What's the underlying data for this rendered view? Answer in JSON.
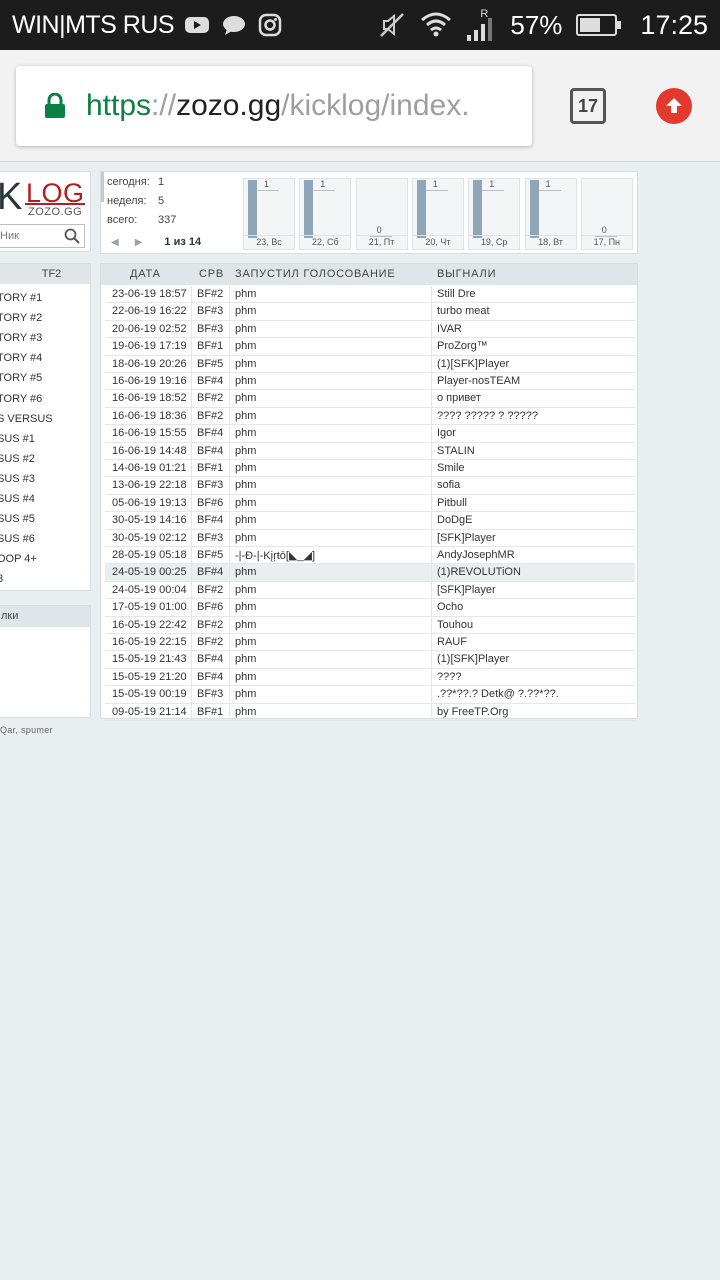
{
  "statusbar": {
    "carrier": "WIN|MTS RUS",
    "network_indicator": "R",
    "battery": "57%",
    "time": "17:25",
    "icons": [
      "youtube-icon",
      "chat-bubble-icon",
      "instagram-icon",
      "mute-icon",
      "wifi-icon",
      "signal-icon",
      "battery-icon"
    ]
  },
  "browser": {
    "url_scheme": "https",
    "url_sep": "://",
    "url_host": "zozo.gg",
    "url_path": "/kicklog/index.",
    "tab_count": "17"
  },
  "logo": {
    "k": "K",
    "log": "LOG",
    "sub": "ZOZO.GG",
    "nick_placeholder": "Ник"
  },
  "stats": {
    "today_label": "сегодня:",
    "today_value": "1",
    "week_label": "неделя:",
    "week_value": "5",
    "total_label": "всего:",
    "total_value": "337",
    "page": "1 из 14",
    "days": [
      {
        "label": "23, Вс",
        "value": 1
      },
      {
        "label": "22, Сб",
        "value": 1
      },
      {
        "label": "21, Пт",
        "value": 0
      },
      {
        "label": "20, Чт",
        "value": 1
      },
      {
        "label": "19, Ср",
        "value": 1
      },
      {
        "label": "18, Вт",
        "value": 1
      },
      {
        "label": "17, Пн",
        "value": 0
      }
    ]
  },
  "sidebar": {
    "header": "TF2",
    "items": [
      "TORY #1",
      "TORY #2",
      "TORY #3",
      "TORY #4",
      "TORY #5",
      "TORY #6",
      "S VERSUS",
      "SUS #1",
      "SUS #2",
      "SUS #3",
      "SUS #4",
      "SUS #5",
      "SUS #6",
      "OOP 4+",
      "3"
    ],
    "header2": "лки",
    "credits": "Qar, spumer"
  },
  "log": {
    "headers": {
      "date": "ДАТА",
      "server": "СРВ",
      "initiator": "ЗАПУСТИЛ ГОЛОСОВАНИЕ",
      "kicked": "ВЫГНАЛИ"
    },
    "rows": [
      {
        "date": "23-06-19 18:57",
        "server": "BF#2",
        "initiator": "phm",
        "kicked": "Still Dre"
      },
      {
        "date": "22-06-19 16:22",
        "server": "BF#3",
        "initiator": "phm",
        "kicked": "turbo meat"
      },
      {
        "date": "20-06-19 02:52",
        "server": "BF#3",
        "initiator": "phm",
        "kicked": "IVAR"
      },
      {
        "date": "19-06-19 17:19",
        "server": "BF#1",
        "initiator": "phm",
        "kicked": "ProZorg™"
      },
      {
        "date": "18-06-19 20:26",
        "server": "BF#5",
        "initiator": "phm",
        "kicked": "(1)[SFK]Player"
      },
      {
        "date": "16-06-19 19:16",
        "server": "BF#4",
        "initiator": "phm",
        "kicked": "Player-nosTEAM"
      },
      {
        "date": "16-06-19 18:52",
        "server": "BF#2",
        "initiator": "phm",
        "kicked": "о привет"
      },
      {
        "date": "16-06-19 18:36",
        "server": "BF#2",
        "initiator": "phm",
        "kicked": "???? ????? ? ?????"
      },
      {
        "date": "16-06-19 15:55",
        "server": "BF#4",
        "initiator": "phm",
        "kicked": "Igor"
      },
      {
        "date": "16-06-19 14:48",
        "server": "BF#4",
        "initiator": "phm",
        "kicked": "STALIN"
      },
      {
        "date": "14-06-19 01:21",
        "server": "BF#1",
        "initiator": "phm",
        "kicked": "Smile"
      },
      {
        "date": "13-06-19 22:18",
        "server": "BF#3",
        "initiator": "phm",
        "kicked": "sofia"
      },
      {
        "date": "05-06-19 19:13",
        "server": "BF#6",
        "initiator": "phm",
        "kicked": "Pitbull"
      },
      {
        "date": "30-05-19 14:16",
        "server": "BF#4",
        "initiator": "phm",
        "kicked": "DoDgE"
      },
      {
        "date": "30-05-19 02:12",
        "server": "BF#3",
        "initiator": "phm",
        "kicked": "[SFK]Player"
      },
      {
        "date": "28-05-19 05:18",
        "server": "BF#5",
        "initiator": "-|-Ð-|-Kįŗŧō[◣_◢]",
        "kicked": "AndyJosephMR"
      },
      {
        "date": "24-05-19 00:25",
        "server": "BF#4",
        "initiator": "phm",
        "kicked": "(1)REVOLUTiON"
      },
      {
        "date": "24-05-19 00:04",
        "server": "BF#2",
        "initiator": "phm",
        "kicked": "[SFK]Player"
      },
      {
        "date": "17-05-19 01:00",
        "server": "BF#6",
        "initiator": "phm",
        "kicked": "Ocho"
      },
      {
        "date": "16-05-19 22:42",
        "server": "BF#2",
        "initiator": "phm",
        "kicked": "Touhou"
      },
      {
        "date": "16-05-19 22:15",
        "server": "BF#2",
        "initiator": "phm",
        "kicked": "RAUF"
      },
      {
        "date": "15-05-19 21:43",
        "server": "BF#4",
        "initiator": "phm",
        "kicked": "(1)[SFK]Player"
      },
      {
        "date": "15-05-19 21:20",
        "server": "BF#4",
        "initiator": "phm",
        "kicked": "????"
      },
      {
        "date": "15-05-19 00:19",
        "server": "BF#3",
        "initiator": "phm",
        "kicked": ".??*??.? Detk@ ?.??*??."
      },
      {
        "date": "09-05-19 21:14",
        "server": "BF#1",
        "initiator": "phm",
        "kicked": "by FreeTP.Org"
      }
    ]
  }
}
